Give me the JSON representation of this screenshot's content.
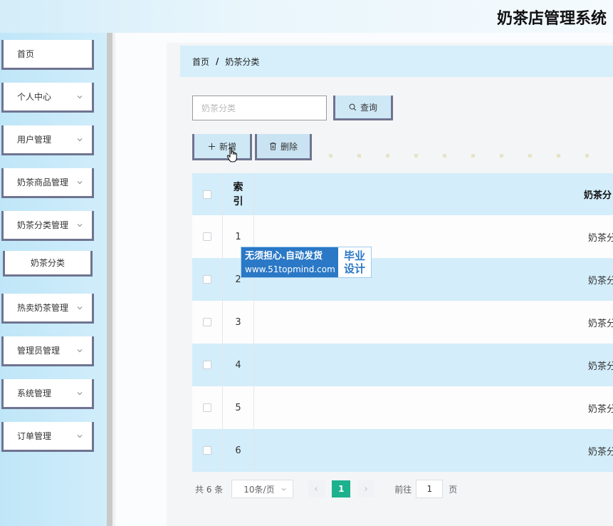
{
  "app": {
    "title": "奶茶店管理系统"
  },
  "sidebar": {
    "items": [
      {
        "label": "首页",
        "has_arrow": false
      },
      {
        "label": "个人中心",
        "has_arrow": true
      },
      {
        "label": "用户管理",
        "has_arrow": true
      },
      {
        "label": "奶茶商品管理",
        "has_arrow": true
      },
      {
        "label": "奶茶分类管理",
        "has_arrow": true,
        "expanded": true
      },
      {
        "label": "热卖奶茶管理",
        "has_arrow": true
      },
      {
        "label": "管理员管理",
        "has_arrow": true
      },
      {
        "label": "系统管理",
        "has_arrow": true
      },
      {
        "label": "订单管理",
        "has_arrow": true
      }
    ],
    "subitem": {
      "label": "奶茶分类"
    }
  },
  "breadcrumb": {
    "home": "首页",
    "separator": "/",
    "current": "奶茶分类"
  },
  "search": {
    "placeholder": "奶茶分类",
    "value": "",
    "button_label": "查询"
  },
  "toolbar": {
    "add_label": "新增",
    "delete_label": "删除"
  },
  "table": {
    "headers": {
      "index": "索引",
      "name": "奶茶分"
    },
    "rows": [
      {
        "index": "1",
        "name": "奶茶分"
      },
      {
        "index": "2",
        "name": "奶茶分"
      },
      {
        "index": "3",
        "name": "奶茶分"
      },
      {
        "index": "4",
        "name": "奶茶分"
      },
      {
        "index": "5",
        "name": "奶茶分"
      },
      {
        "index": "6",
        "name": "奶茶分"
      }
    ]
  },
  "pagination": {
    "total_text": "共 6 条",
    "page_size": "10条/页",
    "current_page": "1",
    "goto_label": "前往",
    "goto_value": "1",
    "goto_unit": "页"
  },
  "watermark": {
    "line1": "无须担心.自动发货",
    "line2": "www.51topmind.com",
    "badge1": "毕业",
    "badge2": "设计"
  },
  "colors": {
    "accent": "#1db18d",
    "header_bg": "#d3edfa",
    "menu_border": "#6f7490",
    "watermark_bg": "#2a78c6"
  }
}
